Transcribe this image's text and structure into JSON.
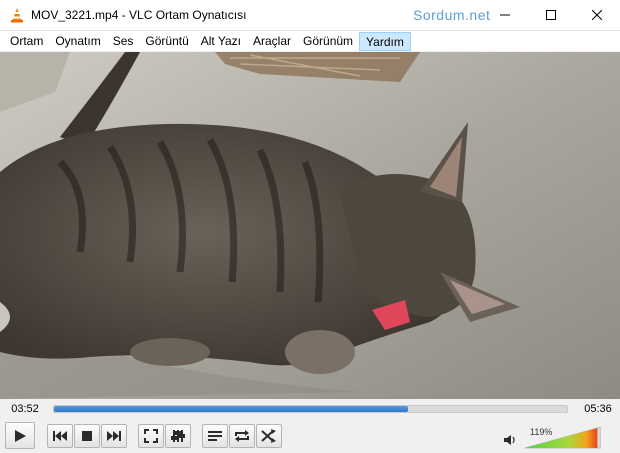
{
  "window": {
    "title": "MOV_3221.mp4 - VLC Ortam Oynatıcısı",
    "watermark": "Sordum.net",
    "accent": "#5a9fd6"
  },
  "menu": {
    "items": [
      {
        "label": "Ortam",
        "name": "menu-ortam"
      },
      {
        "label": "Oynatım",
        "name": "menu-oynatim"
      },
      {
        "label": "Ses",
        "name": "menu-ses"
      },
      {
        "label": "Görüntü",
        "name": "menu-goruntu"
      },
      {
        "label": "Alt Yazı",
        "name": "menu-alt-yazi"
      },
      {
        "label": "Araçlar",
        "name": "menu-araclar"
      },
      {
        "label": "Görünüm",
        "name": "menu-gorunum"
      },
      {
        "label": "Yardım",
        "name": "menu-yardim"
      }
    ],
    "active": "Yardım"
  },
  "player": {
    "elapsed": "03:52",
    "total": "05:36",
    "progress": 0.69,
    "volume_label": "119%",
    "volume": 1.19
  },
  "icons": {
    "app": "vlc-cone-icon",
    "play": "play-icon",
    "prev": "previous-icon",
    "stop": "stop-icon",
    "next": "next-icon",
    "fullscreen": "fullscreen-icon",
    "extended": "extended-settings-icon",
    "playlist": "playlist-icon",
    "loop": "loop-icon",
    "shuffle": "shuffle-icon",
    "speaker": "speaker-icon"
  }
}
